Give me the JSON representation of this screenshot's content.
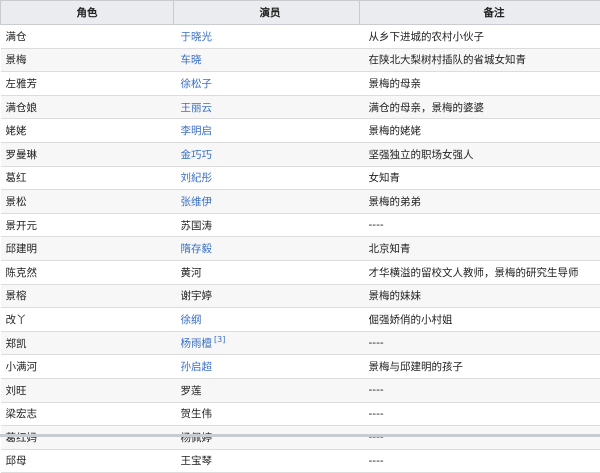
{
  "table": {
    "headers": {
      "role": "角色",
      "actor": "演员",
      "note": "备注"
    },
    "rows": [
      {
        "role": "满仓",
        "actor": "于晓光",
        "actor_link": true,
        "ref": "",
        "note": "从乡下进城的农村小伙子"
      },
      {
        "role": "景梅",
        "actor": "车晓",
        "actor_link": true,
        "ref": "",
        "note": "在陕北大梨树村插队的省城女知青"
      },
      {
        "role": "左雅芳",
        "actor": "徐松子",
        "actor_link": true,
        "ref": "",
        "note": "景梅的母亲"
      },
      {
        "role": "满仓娘",
        "actor": "王丽云",
        "actor_link": true,
        "ref": "",
        "note": "满仓的母亲，景梅的婆婆"
      },
      {
        "role": "姥姥",
        "actor": "李明启",
        "actor_link": true,
        "ref": "",
        "note": "景梅的姥姥"
      },
      {
        "role": "罗曼琳",
        "actor": "金巧巧",
        "actor_link": true,
        "ref": "",
        "note": "坚强独立的职场女强人"
      },
      {
        "role": "葛红",
        "actor": "刘紀彤",
        "actor_link": true,
        "ref": "",
        "note": "女知青"
      },
      {
        "role": "景松",
        "actor": "张维伊",
        "actor_link": true,
        "ref": "",
        "note": "景梅的弟弟"
      },
      {
        "role": "景开元",
        "actor": "苏国涛",
        "actor_link": false,
        "ref": "",
        "note": "----"
      },
      {
        "role": "邱建明",
        "actor": "隋存毅",
        "actor_link": true,
        "ref": "",
        "note": "北京知青"
      },
      {
        "role": "陈克然",
        "actor": "黄河",
        "actor_link": false,
        "ref": "",
        "note": "才华横溢的留校文人教师，景梅的研究生导师"
      },
      {
        "role": "景榕",
        "actor": "谢宇婷",
        "actor_link": false,
        "ref": "",
        "note": "景梅的妹妹"
      },
      {
        "role": "改丫",
        "actor": "徐纲",
        "actor_link": true,
        "ref": "",
        "note": "倔强娇俏的小村姐"
      },
      {
        "role": "郑凯",
        "actor": "杨雨檀",
        "actor_link": true,
        "ref": "[3]",
        "note": "----"
      },
      {
        "role": "小满河",
        "actor": "孙启超",
        "actor_link": true,
        "ref": "",
        "note": "景梅与邱建明的孩子"
      },
      {
        "role": "刘旺",
        "actor": "罗莲",
        "actor_link": false,
        "ref": "",
        "note": "----"
      },
      {
        "role": "梁宏志",
        "actor": "贺生伟",
        "actor_link": false,
        "ref": "",
        "note": "----"
      },
      {
        "role": "葛红妈",
        "actor": "杨佩婷",
        "actor_link": false,
        "ref": "",
        "note": "----"
      },
      {
        "role": "邱母",
        "actor": "王宝琴",
        "actor_link": false,
        "ref": "",
        "note": "----"
      }
    ]
  },
  "colors": {
    "link": "#3a6fc4",
    "header_bg": "#eaecf0",
    "zebra_bg": "#f7f7f7"
  }
}
